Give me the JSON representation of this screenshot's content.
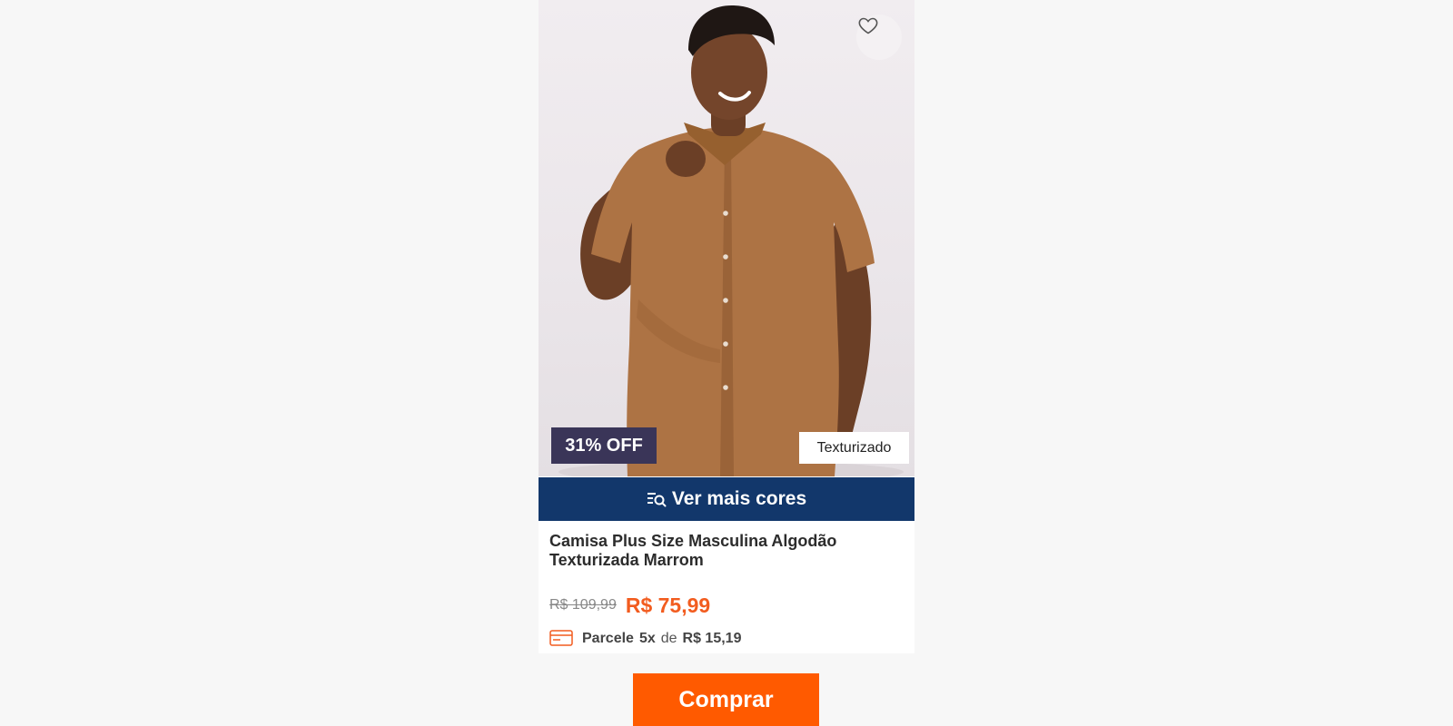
{
  "product": {
    "image_alt": "Homem sorrindo vestindo camisa marrom texturizada",
    "discount_badge": "31% OFF",
    "texture_tag": "Texturizado",
    "favorite_icon": "heart-icon",
    "colors_button": {
      "label": "Ver mais cores",
      "icon": "search-list-icon"
    },
    "title": "Camisa Plus Size Masculina Algodão Texturizada Marrom",
    "old_price": "R$ 109,99",
    "price": "R$ 75,99",
    "installments": {
      "icon": "credit-card-icon",
      "prefix": "Parcele",
      "count": "5x",
      "connector": "de",
      "amount": "R$ 15,19"
    }
  },
  "buy_button": {
    "label": "Comprar"
  },
  "colors": {
    "accent": "#ff5a00",
    "price": "#f25c1f",
    "nav_blue": "#12376b",
    "badge_purple": "#3a3558",
    "shirt_brown": "#ad7344"
  }
}
